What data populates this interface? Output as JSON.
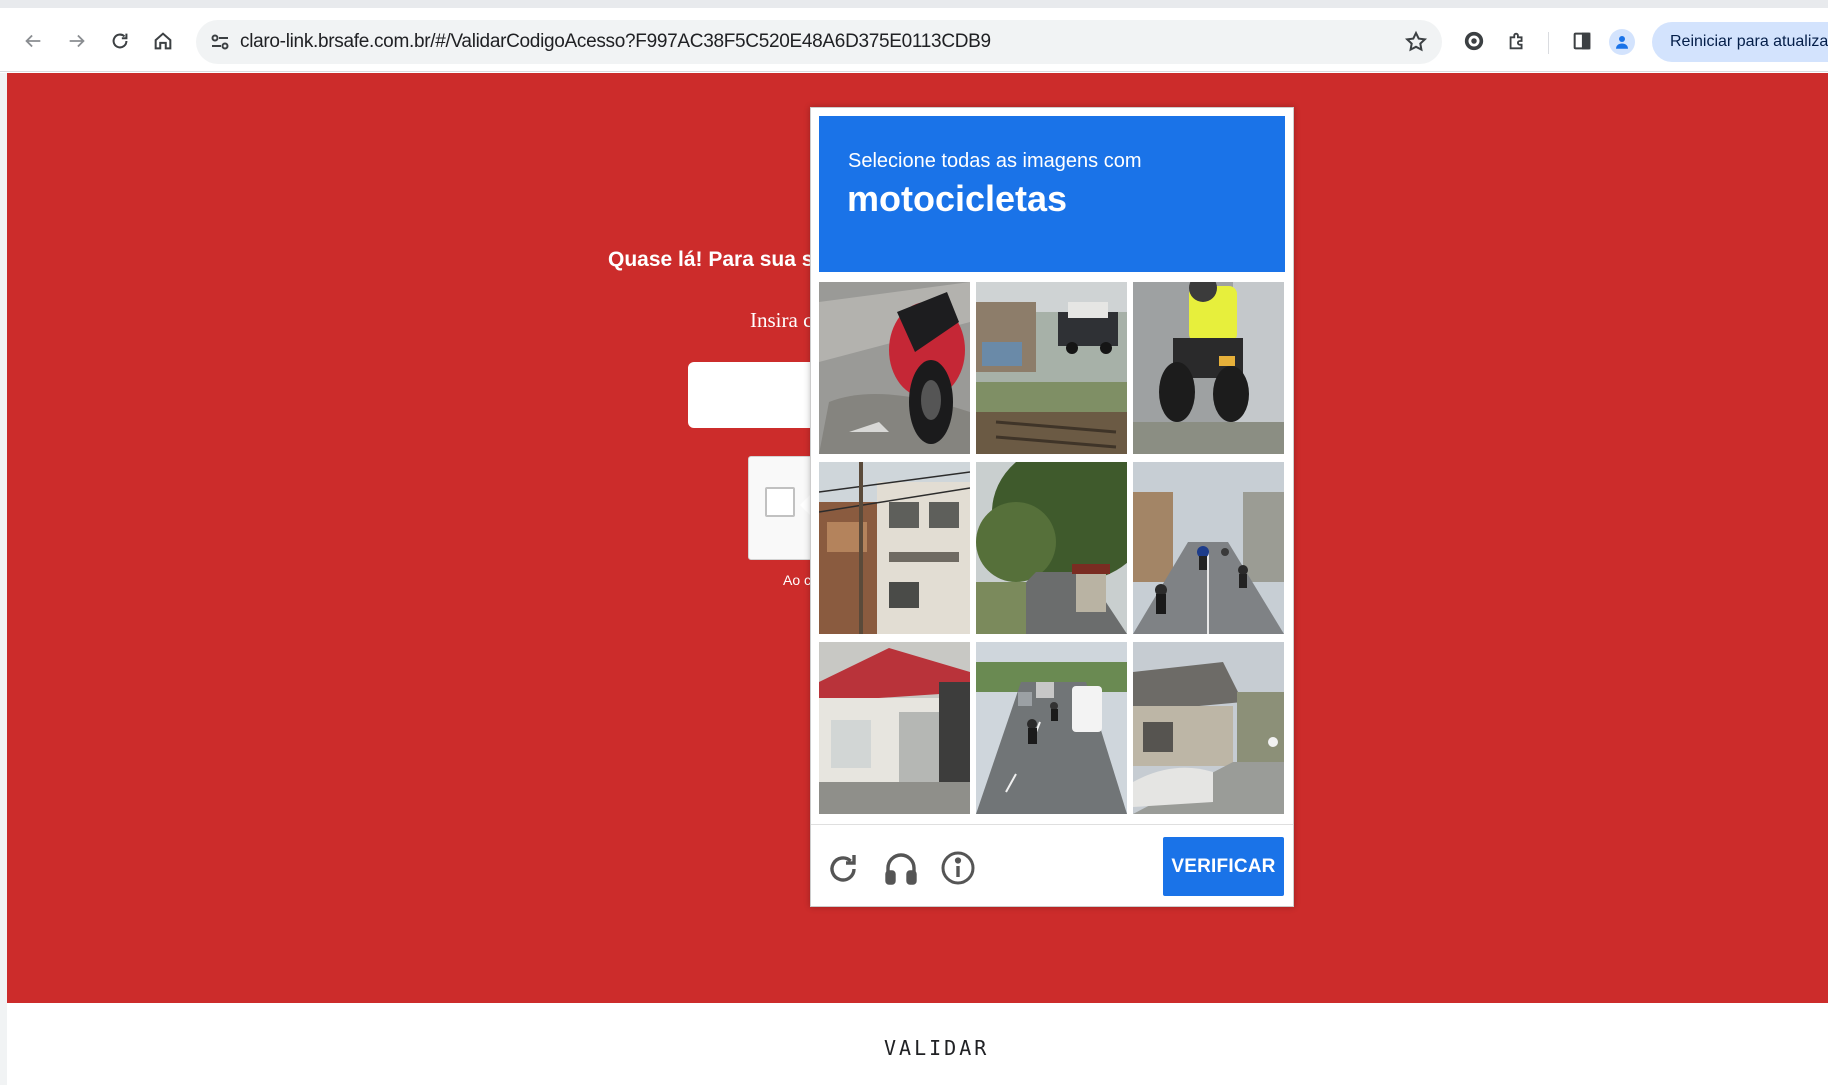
{
  "browser": {
    "url": "claro-link.brsafe.com.br/#/ValidarCodigoAcesso?F997AC38F5C520E48A6D375E0113CDB9",
    "restart_label": "Reiniciar para atualizar",
    "icons": [
      "back-icon",
      "forward-icon",
      "reload-icon",
      "home-icon",
      "site-settings-icon",
      "bookmark-star-icon",
      "extension-shield-icon",
      "extensions-puzzle-icon",
      "side-panel-icon",
      "profile-icon"
    ]
  },
  "page": {
    "headline": "Quase lá! Para sua segu",
    "instruction": "Insira c",
    "terms_text": "Ao c",
    "footer_button": "VALIDAR",
    "code_value": "",
    "colors": {
      "background": "#cc2c2b",
      "text": "#ffffff"
    }
  },
  "challenge": {
    "prompt": "Selecione todas as imagens com",
    "target": "motocicletas",
    "verify_label": "VERIFICAR",
    "header_color": "#1a73e8",
    "tiles": [
      {
        "id": 1,
        "scene": "red motorcycle on pavement"
      },
      {
        "id": 2,
        "scene": "parked trucks by a wall"
      },
      {
        "id": 3,
        "scene": "rider in yellow vest on motorcycle"
      },
      {
        "id": 4,
        "scene": "apartment buildings with power lines"
      },
      {
        "id": 5,
        "scene": "tree-lined road"
      },
      {
        "id": 6,
        "scene": "street with motorcycles"
      },
      {
        "id": 7,
        "scene": "house with red roof"
      },
      {
        "id": 8,
        "scene": "road with traffic and motorcycles"
      },
      {
        "id": 9,
        "scene": "street with houses and parked car"
      }
    ],
    "footer_icons": [
      "reload-icon",
      "audio-headphones-icon",
      "info-icon"
    ]
  }
}
